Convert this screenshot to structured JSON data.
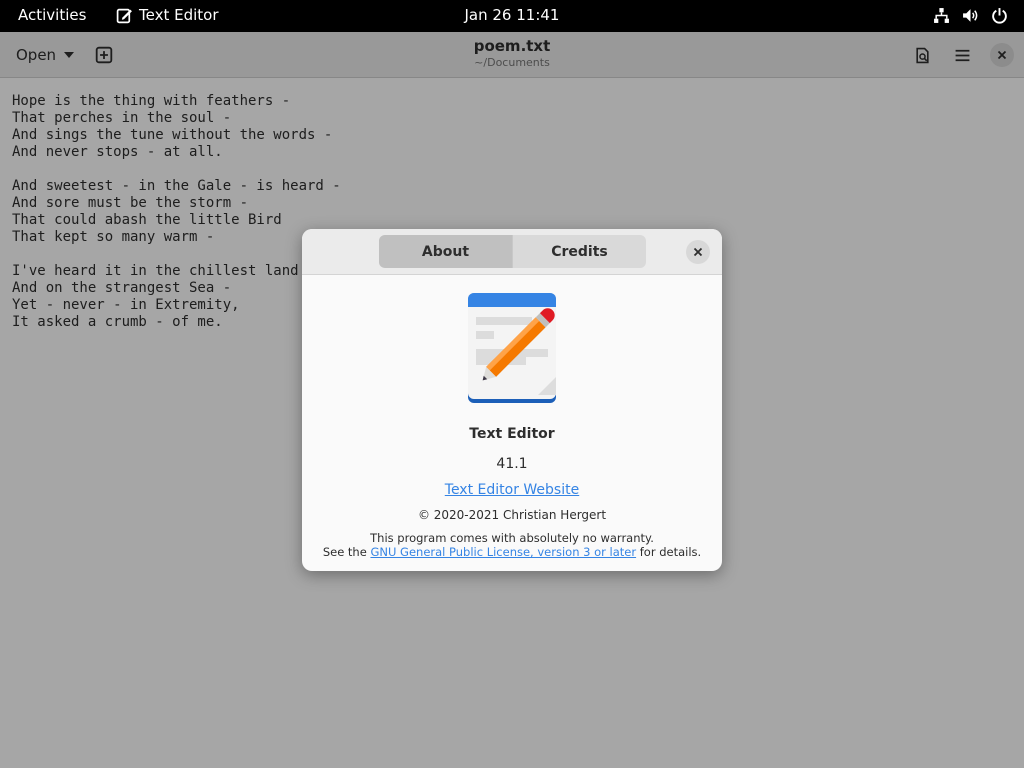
{
  "topbar": {
    "activities": "Activities",
    "app_name": "Text Editor",
    "clock": "Jan 26  11:41"
  },
  "headerbar": {
    "open_label": "Open",
    "title": "poem.txt",
    "subtitle": "~/Documents"
  },
  "editor": {
    "lines": [
      "Hope is the thing with feathers -",
      "That perches in the soul -",
      "And sings the tune without the words -",
      "And never stops - at all.",
      "",
      "And sweetest - in the Gale - is heard -",
      "And sore must be the storm -",
      "That could abash the little Bird",
      "That kept so many warm -",
      "",
      "I've heard it in the chillest land -",
      "And on the strangest Sea -",
      "Yet - never - in Extremity,",
      "It asked a crumb - of me."
    ]
  },
  "about": {
    "tabs": [
      {
        "label": "About",
        "active": true
      },
      {
        "label": "Credits",
        "active": false
      }
    ],
    "app_name": "Text Editor",
    "version": "41.1",
    "website_label": "Text Editor Website",
    "copyright": "© 2020-2021 Christian Hergert",
    "warranty": "This program comes with absolutely no warranty.",
    "license_prefix": "See the ",
    "license_link": "GNU General Public License, version 3 or later",
    "license_suffix": " for details."
  },
  "icons": {
    "app_menu": "text-editor-icon",
    "network": "network-icon",
    "volume": "volume-icon",
    "power": "power-icon",
    "new_tab": "new-tab-icon",
    "search_document": "document-search-icon",
    "menu": "hamburger-menu-icon",
    "close": "close-icon",
    "app_logo": "text-editor-app-icon"
  },
  "colors": {
    "accent": "#3584e4",
    "pencil": "#f57900"
  }
}
